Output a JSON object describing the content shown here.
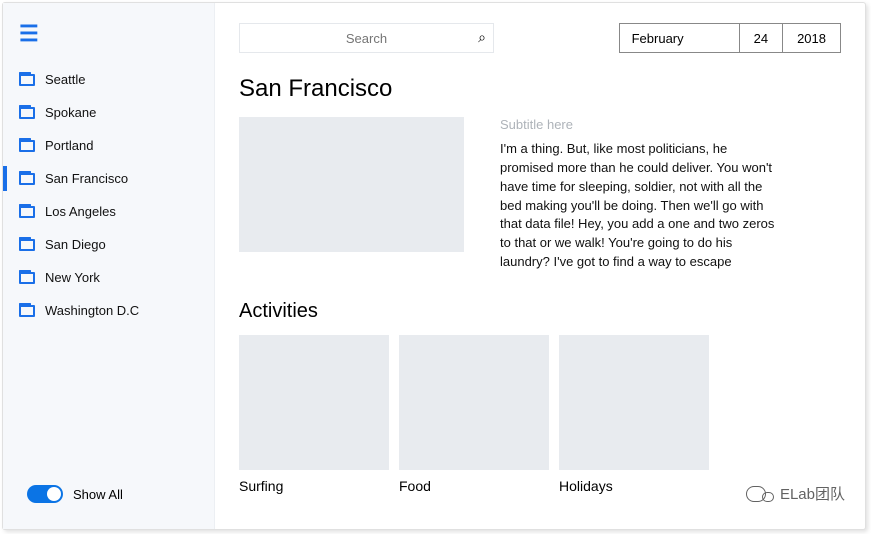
{
  "sidebar": {
    "items": [
      {
        "label": "Seattle"
      },
      {
        "label": "Spokane"
      },
      {
        "label": "Portland"
      },
      {
        "label": "San Francisco"
      },
      {
        "label": "Los Angeles"
      },
      {
        "label": "San Diego"
      },
      {
        "label": "New York"
      },
      {
        "label": "Washington D.C"
      }
    ],
    "active_index": 3,
    "toggle_label": "Show All"
  },
  "search": {
    "placeholder": "Search"
  },
  "date": {
    "month": "February",
    "day": "24",
    "year": "2018"
  },
  "page": {
    "title": "San Francisco",
    "subtitle": "Subtitle here",
    "body": "I'm a thing. But, like most politicians, he promised more than he could deliver. You won't have time for sleeping, soldier, not with all the bed making you'll be doing. Then we'll go with that data file! Hey, you add a one and two zeros to that or we walk! You're going to do his laundry? I've got to find a way to escape"
  },
  "activities": {
    "heading": "Activities",
    "items": [
      {
        "label": "Surfing"
      },
      {
        "label": "Food"
      },
      {
        "label": "Holidays"
      }
    ]
  },
  "watermark": "ELab团队"
}
